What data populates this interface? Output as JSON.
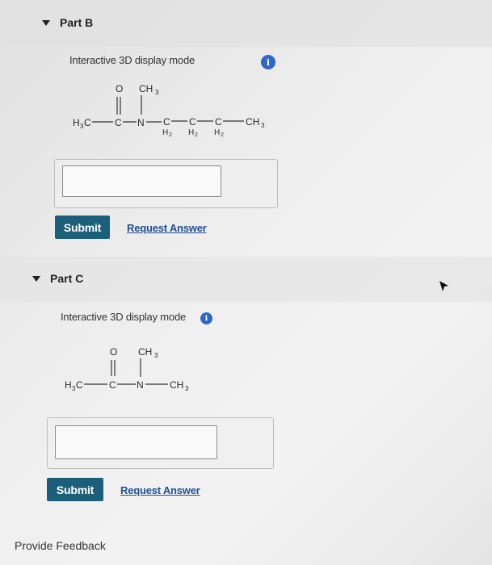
{
  "part_b": {
    "title": "Part B",
    "mode_label": "Interactive 3D display mode",
    "info_icon": "i",
    "structure": {
      "o": "O",
      "ch3_top": "CH",
      "ch3_sub": "3",
      "h3c": "H",
      "h3c_sub": "3",
      "h3c_c": "C",
      "c": "C",
      "n": "N",
      "c1": "C",
      "c2": "C",
      "c3": "C",
      "h2": "H",
      "h2_sub": "2",
      "ch3_end": "CH",
      "ch3_end_sub": "3"
    },
    "answer_value": "",
    "submit_label": "Submit",
    "request_label": "Request Answer"
  },
  "part_c": {
    "title": "Part C",
    "mode_label": "Interactive 3D display mode",
    "info_icon": "i",
    "structure": {
      "o": "O",
      "ch3_top": "CH",
      "ch3_sub": "3",
      "h3c": "H",
      "h3c_sub": "3",
      "h3c_c": "C",
      "c": "C",
      "n": "N",
      "ch3_end": "CH",
      "ch3_end_sub": "3"
    },
    "answer_value": "",
    "submit_label": "Submit",
    "request_label": "Request Answer"
  },
  "footer": {
    "feedback_label": "Provide Feedback"
  }
}
